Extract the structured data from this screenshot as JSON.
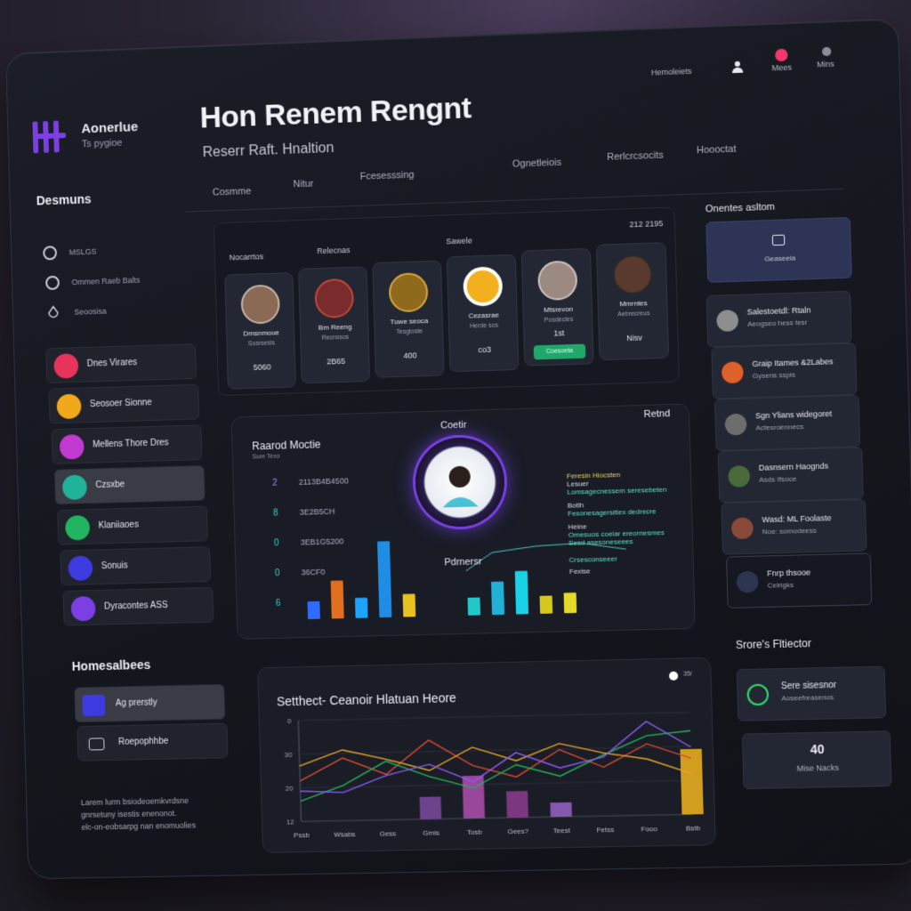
{
  "brand": {
    "name": "Aonerlue",
    "sub": "Ts pygioe"
  },
  "header": {
    "title": "Hon Renem Rengnt",
    "subtitle": "Reserr Raft. Hnaltion",
    "nav": [
      "Cosmme",
      "Nitur",
      "Fcesesssing",
      "Ognetleiois",
      "Rerlcrcsocits",
      "Hoooctat"
    ],
    "top_right": {
      "label": "Hemoleiets",
      "mees": "Mees",
      "mins": "Mins"
    }
  },
  "sidebar": {
    "heading": "Desmuns",
    "radios": [
      "MSLGS",
      "Ommen Raeb Balts",
      "Seoosisa"
    ],
    "items": [
      {
        "label": "Dnes Virares",
        "color": "#e8345a",
        "active": false
      },
      {
        "label": "Seosoer Sionne",
        "color": "#f2a81b",
        "active": false
      },
      {
        "label": "Mellens Thore Dres",
        "color": "#c23ad0",
        "active": false
      },
      {
        "label": "Czsxbe",
        "color": "#20b39a",
        "active": true
      },
      {
        "label": "Klaniiaoes",
        "color": "#22b561",
        "active": false
      },
      {
        "label": "Sonuis",
        "color": "#3d3ae0",
        "active": false
      },
      {
        "label": "Dyracontes ASS",
        "color": "#7b3fe4",
        "active": false
      }
    ],
    "section2_heading": "Homesalbees",
    "section2_items": [
      "Ag prerstly",
      "Roepophhbe"
    ],
    "footer": [
      "Larem lurm bsiodeoemkvrdsne",
      "gnrsetuny isestis enenonot.",
      "elc-on-eobsarpg nan enomuolies"
    ]
  },
  "cards": {
    "headers": [
      "Nocarrtos",
      "Relecnas",
      "Sawele",
      "212 2195"
    ],
    "items": [
      {
        "name": "Dmsnmoue",
        "sub": "Sosrsesis",
        "value": "5060",
        "color": "#8a6a55"
      },
      {
        "name": "Bm Reeng",
        "sub": "Recnssos",
        "value": "2B65",
        "color": "#7a2b2b"
      },
      {
        "name": "Tuwe seoca",
        "sub": "Tesgtoste",
        "value": "400",
        "color": "#8f6a1d"
      },
      {
        "name": "Cezasrae",
        "sub": "Herde sos",
        "value": "co3",
        "color": "#f2b01e"
      },
      {
        "name": "Mtsrevon",
        "sub": "Posdecles",
        "value": "1st",
        "color": "#9a8a82",
        "button": "Coesoeta"
      },
      {
        "name": "Mmrntes",
        "sub": "Aebrecreus",
        "value": "Nisv",
        "color": "#5a3a2e"
      }
    ]
  },
  "main": {
    "title": "Raarod Moctie",
    "small": "Sure Texo",
    "center_title": "Coetir",
    "right_title": "Retnd",
    "stats": [
      {
        "num": "2",
        "text": "2113B4B4500"
      },
      {
        "num": "8",
        "text": "3E2B5CH"
      },
      {
        "num": "0",
        "text": "3EB1G5200"
      },
      {
        "num": "0",
        "text": "36CF0"
      },
      {
        "num": "6",
        "text": ""
      }
    ],
    "annotations": [
      {
        "title": "Feresin Hiocsten",
        "line1": "Lesuer",
        "line2": "Lomsagecnessem seresebeten"
      },
      {
        "title": "Botlh",
        "line1": "Fesonesagersitiex dedrecre",
        "line2": ""
      },
      {
        "title": "Heine",
        "line1": "Omesuos coelar ereornesmes",
        "line2": "Sesd asesoneseees"
      },
      {
        "title": "",
        "line1": "Crsesconseeer",
        "line2": "Fexise"
      }
    ],
    "partner_label": "Pdrnersr",
    "bars": [
      {
        "value": 14,
        "color": "#2f6bff"
      },
      {
        "value": 30,
        "color": "#e36f1e"
      },
      {
        "value": 16,
        "color": "#1ea3ff"
      },
      {
        "value": 60,
        "color": "#1f8de6"
      },
      {
        "value": 18,
        "color": "#e8c21e"
      },
      {
        "value": 14,
        "color": "#22c7c7"
      },
      {
        "value": 26,
        "color": "#22b1d6"
      },
      {
        "value": 34,
        "color": "#1ad2e6"
      },
      {
        "value": 14,
        "color": "#d6c91e"
      },
      {
        "value": 16,
        "color": "#e5d92a"
      }
    ]
  },
  "line_chart": {
    "title": "Setthect- Ceanoir Hlatuan Heore",
    "badge": "35/",
    "y_ticks": [
      "0",
      "30",
      "20",
      "12"
    ],
    "x_labels": [
      "Pssb",
      "Wsabs",
      "Gess",
      "Gmis",
      "Tosb",
      "Gees?",
      "Teest",
      "Fetss",
      "Fooo",
      "Bstb"
    ],
    "series": [
      {
        "color": "#d84a2e",
        "values": [
          40,
          62,
          45,
          78,
          52,
          40,
          66,
          48,
          70,
          55
        ]
      },
      {
        "color": "#23b35a",
        "values": [
          20,
          35,
          58,
          42,
          30,
          52,
          40,
          60,
          78,
          82
        ]
      },
      {
        "color": "#e8a625",
        "values": [
          55,
          70,
          60,
          48,
          70,
          56,
          72,
          62,
          55,
          40
        ]
      },
      {
        "color": "#8b5cf6",
        "values": [
          30,
          28,
          44,
          54,
          36,
          64,
          48,
          58,
          92,
          66
        ]
      }
    ],
    "bars": [
      {
        "x": 4,
        "value": 22,
        "color": "#7d4aa0"
      },
      {
        "x": 5,
        "value": 42,
        "color": "#b04fb0"
      },
      {
        "x": 6,
        "value": 26,
        "color": "#8e3d8e"
      },
      {
        "x": 7,
        "value": 14,
        "color": "#9a62c8"
      },
      {
        "x": 10,
        "value": 64,
        "color": "#f2b51e"
      }
    ]
  },
  "right": {
    "heading": "Onentes asltom",
    "featured": "Geaseela",
    "items": [
      {
        "title": "Salestoetdl: Rtaln",
        "sub": "Aeogseo hess tesr",
        "color": "#8e8e8e"
      },
      {
        "title": "Graip Itames &2Labes",
        "sub": "Gysens sspis",
        "color": "#e0602a"
      },
      {
        "title": "Sgn Ylians widegoret",
        "sub": "Actesroennecs",
        "color": "#6d6d6d"
      },
      {
        "title": "Dasnsern Haognds",
        "sub": "Asds Ifsoce",
        "color": "#4a6a3a"
      },
      {
        "title": "Wasd: ML Foolaste",
        "sub": "Noe: somodeess",
        "color": "#8a4a3a"
      },
      {
        "title": "Fnrp thsooe",
        "sub": "Celrigks",
        "color": "#2d3550"
      }
    ],
    "section2_heading": "Srore's Fltiector",
    "s2_card": {
      "title": "Sere sisesnor",
      "sub": "Aoseefreasenos"
    },
    "stat_card": {
      "value": "40",
      "label": "Mise Nacks"
    }
  }
}
